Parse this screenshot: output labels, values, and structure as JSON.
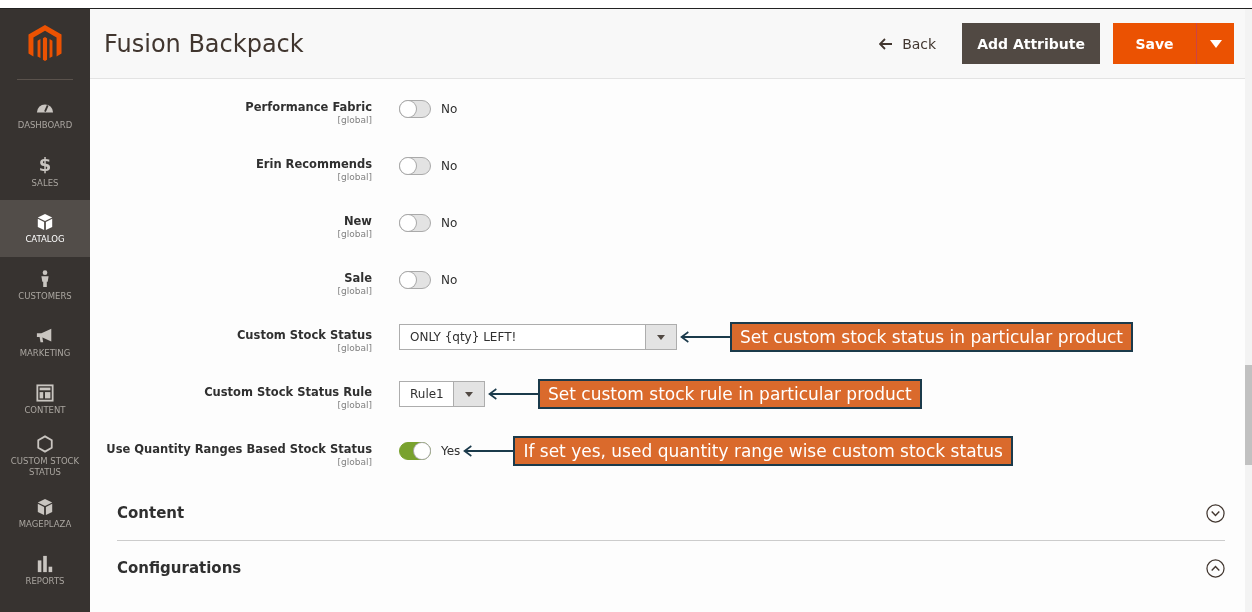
{
  "sidebar": {
    "items": [
      {
        "label": "DASHBOARD",
        "selected": false
      },
      {
        "label": "SALES",
        "glyph": "$",
        "selected": false
      },
      {
        "label": "CATALOG",
        "selected": true
      },
      {
        "label": "CUSTOMERS",
        "selected": false
      },
      {
        "label": "MARKETING",
        "selected": false
      },
      {
        "label": "CONTENT",
        "selected": false
      },
      {
        "label": "CUSTOM STOCK STATUS",
        "selected": false
      },
      {
        "label": "MAGEPLAZA",
        "selected": false
      },
      {
        "label": "REPORTS",
        "selected": false
      }
    ]
  },
  "header": {
    "title": "Fusion Backpack",
    "back": "Back",
    "add_button": "Add Attribute",
    "save_button": "Save"
  },
  "fields": [
    {
      "label": "Performance Fabric",
      "scope": "[global]",
      "kind": "toggle",
      "on": false,
      "value": "No"
    },
    {
      "label": "Erin Recommends",
      "scope": "[global]",
      "kind": "toggle",
      "on": false,
      "value": "No"
    },
    {
      "label": "New",
      "scope": "[global]",
      "kind": "toggle",
      "on": false,
      "value": "No"
    },
    {
      "label": "Sale",
      "scope": "[global]",
      "kind": "toggle",
      "on": false,
      "value": "No"
    },
    {
      "label": "Custom Stock Status",
      "scope": "[global]",
      "kind": "select",
      "wide": true,
      "value": "ONLY {qty} LEFT!",
      "annotation": "Set custom stock status in particular product"
    },
    {
      "label": "Custom Stock Status Rule",
      "scope": "[global]",
      "kind": "select",
      "wide": false,
      "value": "Rule1",
      "annotation": "Set custom stock rule in particular product"
    },
    {
      "label": "Use Quantity Ranges Based Stock Status",
      "scope": "[global]",
      "kind": "toggle",
      "on": true,
      "value": "Yes",
      "annotation": "If set yes, used quantity range wise custom stock status"
    }
  ],
  "sections": [
    {
      "title": "Content",
      "expanded": false
    },
    {
      "title": "Configurations",
      "expanded": true
    }
  ]
}
